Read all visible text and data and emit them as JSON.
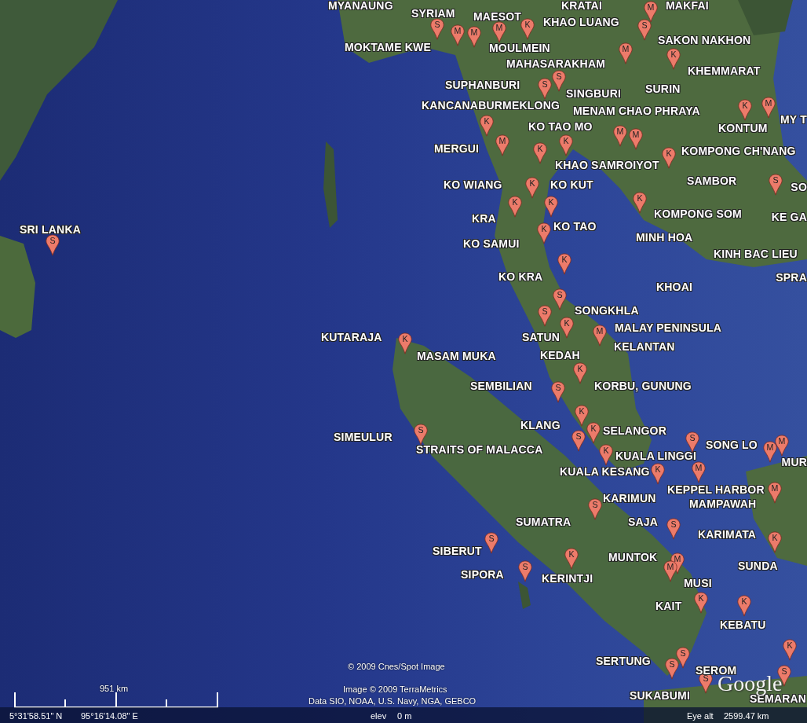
{
  "map": {
    "labels": [
      {
        "text": "MYANAUNG"
      },
      {
        "text": "KRATAI"
      },
      {
        "text": "MAKFAI"
      },
      {
        "text": "SYRIAM"
      },
      {
        "text": "MAESOT"
      },
      {
        "text": "KHAO LUANG"
      },
      {
        "text": "MOKTAME KWE"
      },
      {
        "text": "MOULMEIN"
      },
      {
        "text": "SAKON NAKHON"
      },
      {
        "text": "MAHASARAKHAM"
      },
      {
        "text": "KHEMMARAT"
      },
      {
        "text": "SUPHANBURI"
      },
      {
        "text": "SINGBURI"
      },
      {
        "text": "SURIN"
      },
      {
        "text": "KANCANABURMEKLONG"
      },
      {
        "text": "MENAM CHAO PHRAYA"
      },
      {
        "text": "KONTUM"
      },
      {
        "text": "MY T"
      },
      {
        "text": "KO TAO MO"
      },
      {
        "text": "MERGUI"
      },
      {
        "text": "KOMPONG CH'NANG"
      },
      {
        "text": "KHAO SAMROIYOT"
      },
      {
        "text": "KO WIANG"
      },
      {
        "text": "KO KUT"
      },
      {
        "text": "SAMBOR"
      },
      {
        "text": "SO"
      },
      {
        "text": "KRA"
      },
      {
        "text": "KOMPONG SOM"
      },
      {
        "text": "KE GA"
      },
      {
        "text": "KO TAO"
      },
      {
        "text": "KO SAMUI"
      },
      {
        "text": "MINH HOA"
      },
      {
        "text": "KINH BAC LIEU"
      },
      {
        "text": "SPRA"
      },
      {
        "text": "KO KRA"
      },
      {
        "text": "KHOAI"
      },
      {
        "text": "SONGKHLA"
      },
      {
        "text": "MALAY PENINSULA"
      },
      {
        "text": "KUTARAJA"
      },
      {
        "text": "SATUN"
      },
      {
        "text": "KELANTAN"
      },
      {
        "text": "MASAM MUKA"
      },
      {
        "text": "KEDAH"
      },
      {
        "text": "SEMBILIAN"
      },
      {
        "text": "KORBU, GUNUNG"
      },
      {
        "text": "KLANG"
      },
      {
        "text": "SELANGOR"
      },
      {
        "text": "SIMEULUR"
      },
      {
        "text": "SONG LO"
      },
      {
        "text": "STRAITS OF MALACCA"
      },
      {
        "text": "KUALA LINGGI"
      },
      {
        "text": "MUR"
      },
      {
        "text": "KUALA KESANG"
      },
      {
        "text": "KEPPEL HARBOR"
      },
      {
        "text": "KARIMUN"
      },
      {
        "text": "MAMPAWAH"
      },
      {
        "text": "SUMATRA"
      },
      {
        "text": "SAJA"
      },
      {
        "text": "KARIMATA"
      },
      {
        "text": "SIBERUT"
      },
      {
        "text": "MUNTOK"
      },
      {
        "text": "SUNDA"
      },
      {
        "text": "SIPORA"
      },
      {
        "text": "KERINTJI"
      },
      {
        "text": "MUSI"
      },
      {
        "text": "KAIT"
      },
      {
        "text": "KEBATU"
      },
      {
        "text": "SERTUNG"
      },
      {
        "text": "SEROM"
      },
      {
        "text": "SUKABUMI"
      },
      {
        "text": "SEMARAN"
      },
      {
        "text": "SRI LANKA"
      }
    ],
    "pins": [
      {
        "letter": "S"
      },
      {
        "letter": "M"
      },
      {
        "letter": "M"
      },
      {
        "letter": "M"
      },
      {
        "letter": "K"
      },
      {
        "letter": "M"
      },
      {
        "letter": "S"
      },
      {
        "letter": "M"
      },
      {
        "letter": "K"
      },
      {
        "letter": "S"
      },
      {
        "letter": "S"
      },
      {
        "letter": "K"
      },
      {
        "letter": "M"
      },
      {
        "letter": "M"
      },
      {
        "letter": "M"
      },
      {
        "letter": "K"
      },
      {
        "letter": "K"
      },
      {
        "letter": "K"
      },
      {
        "letter": "S"
      },
      {
        "letter": "K"
      },
      {
        "letter": "M"
      },
      {
        "letter": "K"
      },
      {
        "letter": "K"
      },
      {
        "letter": "K"
      },
      {
        "letter": "K"
      },
      {
        "letter": "K"
      },
      {
        "letter": "K"
      },
      {
        "letter": "S"
      },
      {
        "letter": "S"
      },
      {
        "letter": "K"
      },
      {
        "letter": "M"
      },
      {
        "letter": "K"
      },
      {
        "letter": "K"
      },
      {
        "letter": "S"
      },
      {
        "letter": "K"
      },
      {
        "letter": "S"
      },
      {
        "letter": "K"
      },
      {
        "letter": "K"
      },
      {
        "letter": "S"
      },
      {
        "letter": "M"
      },
      {
        "letter": "M"
      },
      {
        "letter": "S"
      },
      {
        "letter": "K"
      },
      {
        "letter": "M"
      },
      {
        "letter": "M"
      },
      {
        "letter": "S"
      },
      {
        "letter": "S"
      },
      {
        "letter": "K"
      },
      {
        "letter": "S"
      },
      {
        "letter": "S"
      },
      {
        "letter": "K"
      },
      {
        "letter": "M"
      },
      {
        "letter": "M"
      },
      {
        "letter": "K"
      },
      {
        "letter": "K"
      },
      {
        "letter": "S"
      },
      {
        "letter": "S"
      },
      {
        "letter": "S"
      },
      {
        "letter": "K"
      },
      {
        "letter": "S"
      },
      {
        "letter": "S"
      }
    ],
    "attributions": [
      "© 2009 Cnes/Spot Image",
      "Image © 2009 TerraMetrics",
      "Data SIO, NOAA, U.S. Navy, NGA, GEBCO"
    ],
    "logo": "Google",
    "scale_bar": {
      "label": "951 km"
    }
  },
  "status_bar": {
    "latitude": "5°31'58.51\" N",
    "longitude": "95°16'14.08\" E",
    "elevation_label": "elev",
    "elevation": "0 m",
    "eye_alt_label": "Eye alt",
    "eye_alt": "2599.47 km"
  }
}
